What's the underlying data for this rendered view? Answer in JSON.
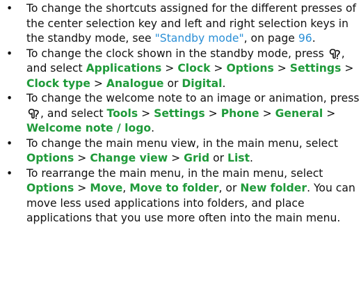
{
  "bullet": "•",
  "colors": {
    "ui_term": "#1f9a3a",
    "link": "#2a8fd6",
    "text": "#111111"
  },
  "icon": "menu-key-icon",
  "items": [
    {
      "t1": "To change the shortcuts assigned for the different presses of the center selection key and left and right selection keys in the standby mode, see ",
      "link": "\"Standby mode\"",
      "t2": ", on page ",
      "page": "96",
      "t3": "."
    },
    {
      "t1": "To change the clock shown in the standby mode, press ",
      "t2": ", and select ",
      "a": "Applications",
      "s1": " > ",
      "b": "Clock",
      "s2": " > ",
      "c": "Options",
      "s3": " > ",
      "d": "Settings",
      "s4": " > ",
      "e": "Clock type",
      "s5": " > ",
      "f": "Analogue",
      "or": " or ",
      "g": "Digital",
      "end": "."
    },
    {
      "t1": "To change the welcome note to an image or animation, press ",
      "t2": ", and select ",
      "a": "Tools",
      "s1": " > ",
      "b": "Settings",
      "s2": " > ",
      "c": "Phone",
      "s3": " > ",
      "d": "General",
      "s4": " > ",
      "e": "Welcome note / logo",
      "end": "."
    },
    {
      "t1": "To change the main menu view, in the main menu, select ",
      "a": "Options",
      "s1": " > ",
      "b": "Change view",
      "s2": " > ",
      "c": "Grid",
      "or": " or ",
      "d": "List",
      "end": "."
    },
    {
      "t1": "To rearrange the main menu, in the main menu, select ",
      "a": "Options",
      "s1": " > ",
      "b": "Move",
      "c1": ", ",
      "c": "Move to folder",
      "c2": ", or ",
      "d": "New folder",
      "end": ". You can move less used applications into folders, and place applications that you use more often into the main menu."
    }
  ]
}
